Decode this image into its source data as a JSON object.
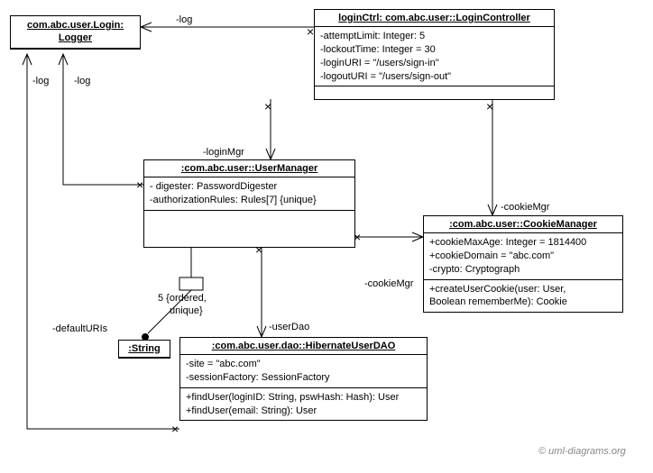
{
  "logger": {
    "title": "com.abc.user.Login: Logger"
  },
  "loginCtrl": {
    "title": "loginCtrl: com.abc.user::LoginController",
    "a1": "-attemptLimit: Integer: 5",
    "a2": "-lockoutTime: Integer = 30",
    "a3": "-loginURI = \"/users/sign-in\"",
    "a4": "-logoutURI = \"/users/sign-out\""
  },
  "userMgr": {
    "title": ":com.abc.user::UserManager",
    "a1": "- digester: PasswordDigester",
    "a2": "-authorizationRules: Rules[7] {unique}"
  },
  "cookieMgr": {
    "title": ":com.abc.user::CookieManager",
    "a1": "+cookieMaxAge: Integer = 1814400",
    "a2": "+cookieDomain = \"abc.com\"",
    "a3": "-crypto: Cryptograph",
    "op1a": "+createUserCookie(user: User,",
    "op1b": "Boolean rememberMe): Cookie"
  },
  "stringBox": {
    "title": ":String"
  },
  "dao": {
    "title": ":com.abc.user.dao::HibernateUserDAO",
    "a1": "-site = \"abc.com\"",
    "a2": "-sessionFactory: SessionFactory",
    "op1": "+findUser(loginID: String, pswHash: Hash): User",
    "op2": "+findUser(email: String): User"
  },
  "labels": {
    "log1": "-log",
    "log2": "-log",
    "log3": "-log",
    "loginMgr": "-loginMgr",
    "cookieMgr1": "-cookieMgr",
    "cookieMgr2": "-cookieMgr",
    "defaultURIs": "-defaultURIs",
    "ordered": "5 {ordered,",
    "unique": "unique}",
    "userDao": "-userDao"
  },
  "watermark": "© uml-diagrams.org"
}
